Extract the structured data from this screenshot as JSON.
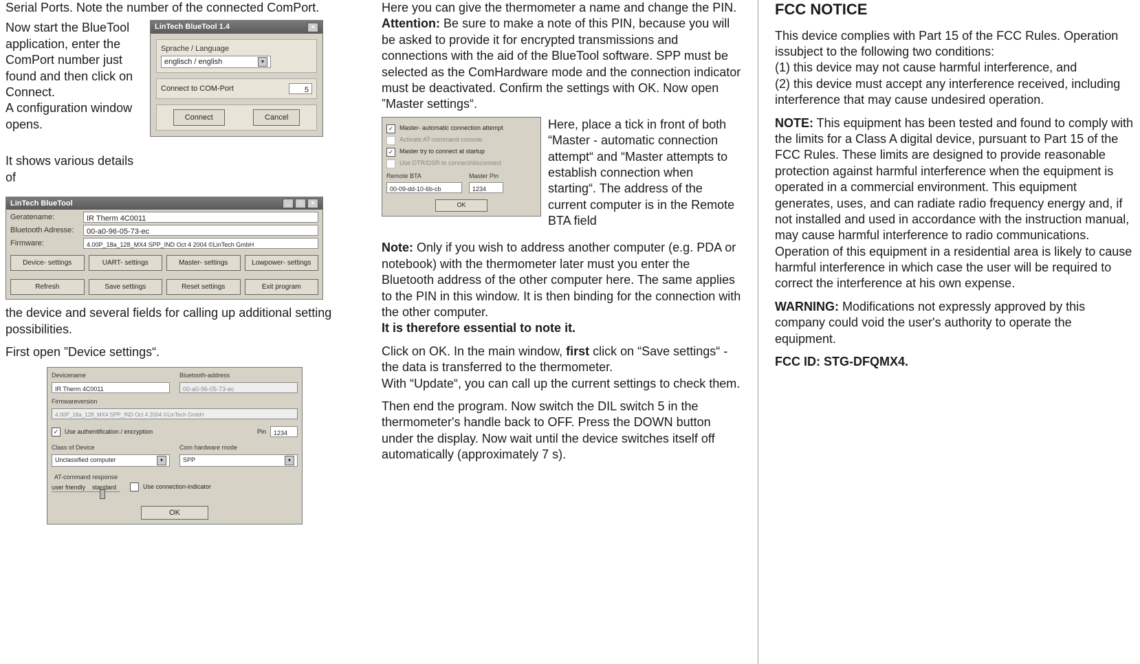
{
  "col1": {
    "intro1": "Serial Ports. Note the number of the connected ComPort.",
    "intro2a": "Now start the BlueTool application, enter the ComPort number just found and then click on Connect.",
    "intro2b": "A configuration window opens.",
    "intro3": "It shows various details of",
    "afterBig": "the device and several fields for calling up additional setting possibilities.",
    "afterBig2": "First open ”Device settings“.",
    "dlg1": {
      "title": "LinTech BlueTool 1.4",
      "grp1_label": "Sprache / Language",
      "grp1_value": "englisch / english",
      "grp2_label": "Connect to COM-Port",
      "grp2_value": "5",
      "btn_connect": "Connect",
      "btn_cancel": "Cancel"
    },
    "dlg2": {
      "title": "LinTech BlueTool",
      "f1_label": "Geratename:",
      "f1_value": "IR Therm 4C0011",
      "f2_label": "Bluetooth Adresse:",
      "f2_value": "00-a0-96-05-73-ec",
      "f3_label": "Firmware:",
      "f3_value": "4.00P_18a_128_MX4 SPP_IND Oct  4 2004 ©LinTech GmbH",
      "b1": "Device- settings",
      "b2": "UART- settings",
      "b3": "Master- settings",
      "b4": "Lowpower- settings",
      "b5": "Refresh",
      "b6": "Save settings",
      "b7": "Reset settings",
      "b8": "Exit program"
    },
    "dlg3": {
      "devname_label": "Devicename",
      "devname_value": "IR Therm 4C0011",
      "btaddr_label": "Bluetooth-address",
      "btaddr_value": "00-a0-96-05-73-ec",
      "fw_label": "Firmwareversion",
      "fw_value": "4.00P_18a_128_MX4 SPP_IND Oct  4 2004 ©LinTech GmbH",
      "auth_label": "Use authentification / encryption",
      "pin_label": "Pin",
      "pin_value": "1234",
      "class_label": "Class of Device",
      "class_value": "Unclassified computer",
      "hw_label": "Com hardware mode",
      "hw_value": "SPP",
      "at_label": "AT-command response",
      "at_user": "user friendly",
      "at_std": "standard",
      "conn_ind": "Use connection-indicator",
      "ok": "OK"
    }
  },
  "col2": {
    "p1": "Here you can give the thermometer a name and change the PIN.",
    "att_label": "Attention:",
    "att_text": " Be sure to make a note of this PIN, because you will be asked to provide it for encrypted transmissions and connections with the aid of the BlueTool software. SPP must be selected as the ComHardware mode and the connection indicator must be deactivated. Confirm the settings with OK. Now open ”Master settings“.",
    "side": "Here, place a tick in front of both “Master - automatic connection attempt“ and “Master attempts to establish connection when starting“. The address of the current computer is in the Remote BTA field",
    "note_label": "Note:",
    "note_text": " Only if you wish to address another computer (e.g. PDA or notebook) with the thermometer later must you enter the Bluetooth address of the other computer here. The same applies to the PIN in this window. It is then binding for the connection with the other computer.",
    "note_bold": "It is therefore essential to note it.",
    "p3a": "Click on OK. In the main window, ",
    "p3_first": "first",
    "p3b": " click on “Save settings“ - the data is transferred to the thermometer.",
    "p4": "With “Update“, you can call up the current settings to check them.",
    "p5": "Then end the program. Now switch the DIL switch 5 in the thermometer's handle back to OFF. Press the DOWN button under the display. Now wait until the device switches itself off automatically (approximately 7 s).",
    "dlg4": {
      "c1": "Master- automatic connection attempt",
      "c2": "Activate AT-command console",
      "c3": "Master try to connect at startup",
      "c4": "Use DTR/DSR to connect/disconnect",
      "rbta_label": "Remote BTA",
      "rbta_value": "00-09-dd-10-6b-cb",
      "mpin_label": "Master Pin",
      "mpin_value": "1234",
      "ok": "OK"
    }
  },
  "col3": {
    "title": "FCC NOTICE",
    "p1": "This device complies with Part 15 of the FCC Rules. Operation issubject to the following two conditions:",
    "p1a": "(1) this device may not cause harmful interference, and",
    "p1b": "(2) this device must accept any interference received, including interference that may cause undesired operation.",
    "note_label": "NOTE:",
    "note_text": " This equipment has been tested and found to comply with the limits for a Class A digital device, pursuant to Part 15 of the FCC Rules. These limits are designed to provide reasonable protection against harmful interference when the equipment is operated in a commercial environment. This equipment generates, uses, and can radiate radio frequency energy and, if not installed and used in accordance with the instruction manual, may cause harmful interference to radio communications. Operation of this equipment in a residential area is likely to cause harmful interference in which case the user will be required to correct the interference at his own expense.",
    "warn_label": "WARNING:",
    "warn_text": " Modifications not expressly approved by this company could void the user's authority to operate the equipment.",
    "fccid": "FCC ID: STG-DFQMX4."
  }
}
